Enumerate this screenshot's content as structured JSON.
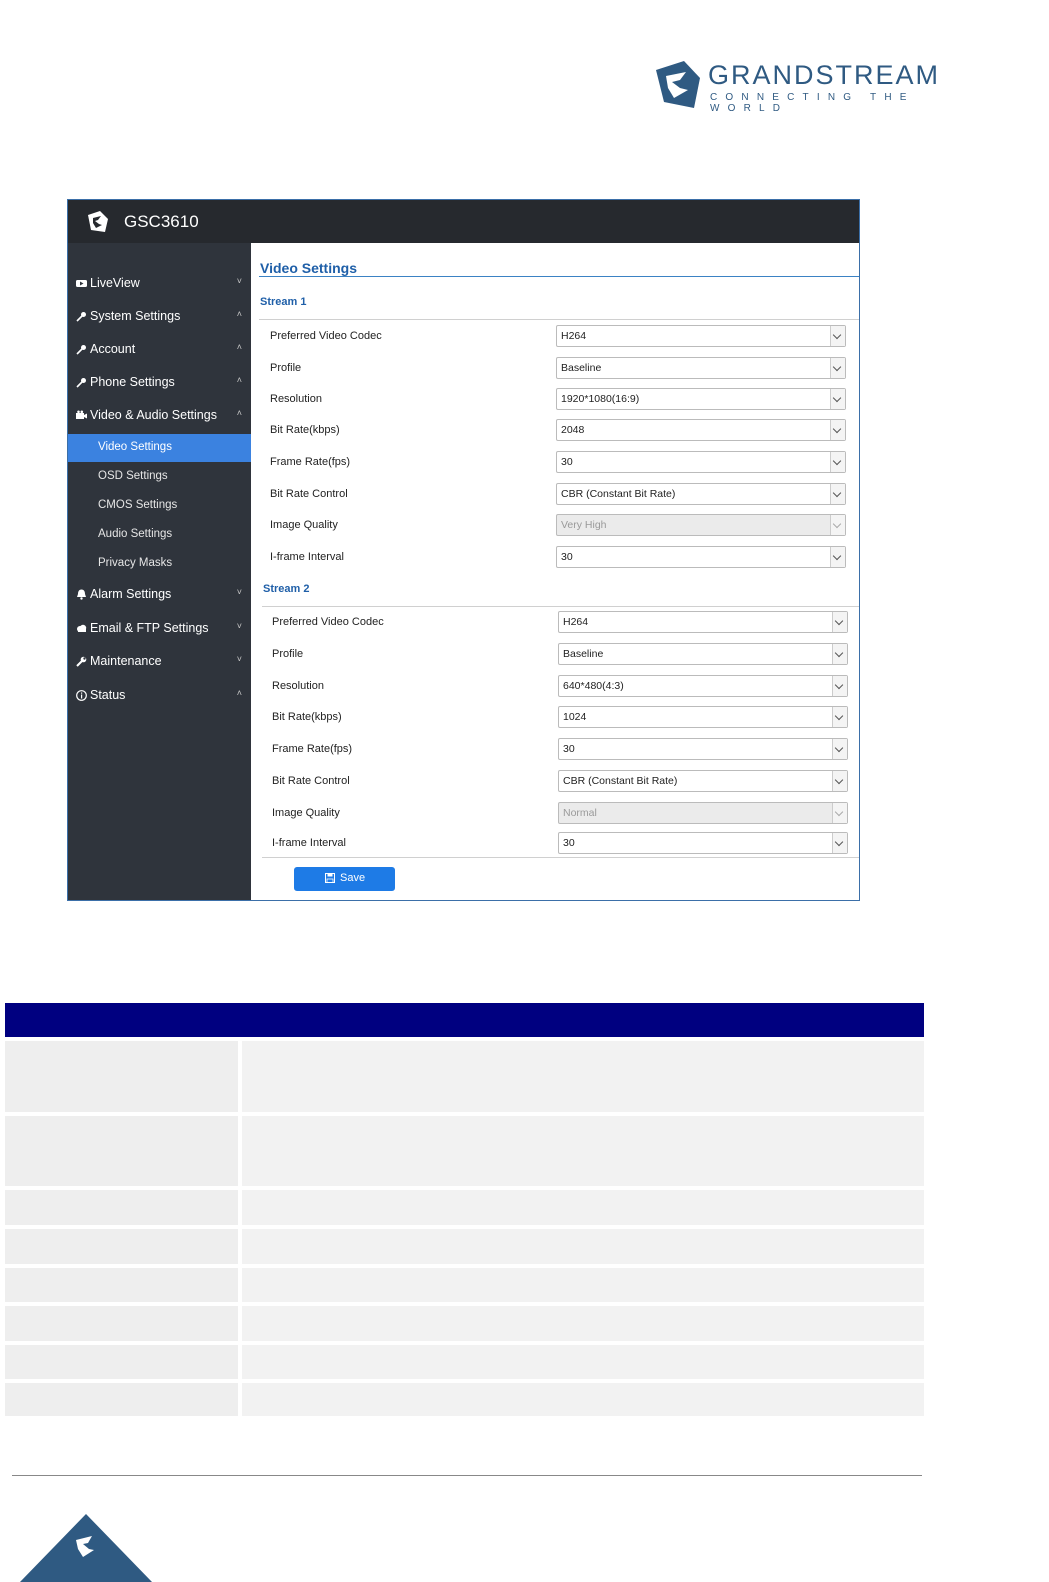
{
  "brand": {
    "name": "GRANDSTREAM",
    "tagline": "CONNECTING THE WORLD",
    "color": "#2f5a82"
  },
  "app": {
    "title": "GSC3610"
  },
  "sidebar": {
    "items": [
      {
        "label": "LiveView",
        "icon": "video-icon",
        "caret": "˅"
      },
      {
        "label": "System Settings",
        "icon": "key-icon",
        "caret": "˄"
      },
      {
        "label": "Account",
        "icon": "key-icon",
        "caret": "˄"
      },
      {
        "label": "Phone Settings",
        "icon": "key-icon",
        "caret": "˄"
      },
      {
        "label": "Video & Audio Settings",
        "icon": "camera-icon",
        "caret": "˄"
      }
    ],
    "subitems": [
      {
        "label": "Video Settings",
        "active": true
      },
      {
        "label": "OSD Settings"
      },
      {
        "label": "CMOS Settings"
      },
      {
        "label": "Audio Settings"
      },
      {
        "label": "Privacy Masks"
      }
    ],
    "items_after": [
      {
        "label": "Alarm Settings",
        "icon": "bell-icon",
        "caret": "˅"
      },
      {
        "label": "Email & FTP Settings",
        "icon": "cloud-icon",
        "caret": "˅"
      },
      {
        "label": "Maintenance",
        "icon": "wrench-icon",
        "caret": "˅"
      },
      {
        "label": "Status",
        "icon": "info-icon",
        "caret": "˄"
      }
    ]
  },
  "main": {
    "title": "Video Settings",
    "streams": [
      {
        "heading": "Stream 1",
        "fields": [
          {
            "label": "Preferred Video Codec",
            "value": "H264"
          },
          {
            "label": "Profile",
            "value": "Baseline"
          },
          {
            "label": "Resolution",
            "value": "1920*1080(16:9)"
          },
          {
            "label": "Bit Rate(kbps)",
            "value": "2048"
          },
          {
            "label": "Frame Rate(fps)",
            "value": "30"
          },
          {
            "label": "Bit Rate Control",
            "value": "CBR (Constant Bit Rate)"
          },
          {
            "label": "Image Quality",
            "value": "Very High",
            "disabled": true
          },
          {
            "label": "I-frame Interval",
            "value": "30"
          }
        ]
      },
      {
        "heading": "Stream 2",
        "fields": [
          {
            "label": "Preferred Video Codec",
            "value": "H264"
          },
          {
            "label": "Profile",
            "value": "Baseline"
          },
          {
            "label": "Resolution",
            "value": "640*480(4:3)"
          },
          {
            "label": "Bit Rate(kbps)",
            "value": "1024"
          },
          {
            "label": "Frame Rate(fps)",
            "value": "30"
          },
          {
            "label": "Bit Rate Control",
            "value": "CBR (Constant Bit Rate)"
          },
          {
            "label": "Image Quality",
            "value": "Normal",
            "disabled": true
          },
          {
            "label": "I-frame Interval",
            "value": "30"
          }
        ]
      }
    ],
    "save_label": "Save"
  },
  "colors": {
    "accent": "#1e7be6",
    "sidebar": "#2f343c",
    "topbar": "#26292e",
    "table_header": "#000080"
  }
}
